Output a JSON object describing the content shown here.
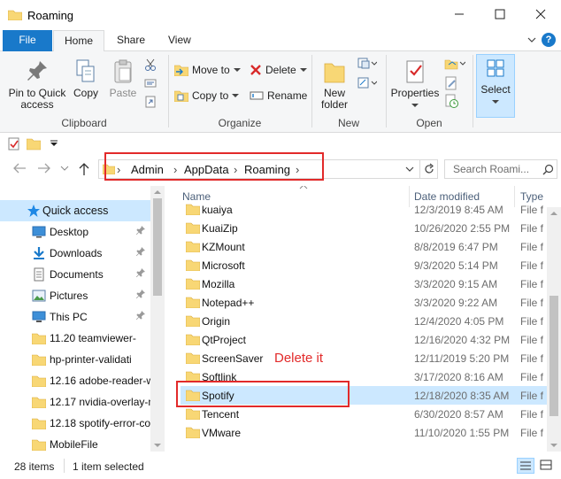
{
  "window": {
    "title": "Roaming"
  },
  "tabs": [
    {
      "label": "File"
    },
    {
      "label": "Home"
    },
    {
      "label": "Share"
    },
    {
      "label": "View"
    }
  ],
  "ribbon": {
    "clipboard": {
      "label": "Clipboard",
      "pin": "Pin to Quick\naccess",
      "pin_l1": "Pin to Quick",
      "pin_l2": "access",
      "copy": "Copy",
      "paste": "Paste"
    },
    "organize": {
      "label": "Organize",
      "move_to": "Move to",
      "copy_to": "Copy to",
      "delete": "Delete",
      "rename": "Rename"
    },
    "new": {
      "label": "New",
      "new_folder_l1": "New",
      "new_folder_l2": "folder"
    },
    "open": {
      "label": "Open",
      "properties": "Properties"
    },
    "select": {
      "label": "Select"
    }
  },
  "address": {
    "crumbs": [
      "Admin",
      "AppData",
      "Roaming"
    ],
    "search_placeholder": "Search Roami..."
  },
  "nav": {
    "items": [
      {
        "label": "Quick access",
        "pinned": false
      },
      {
        "label": "Desktop",
        "pinned": true
      },
      {
        "label": "Downloads",
        "pinned": true
      },
      {
        "label": "Documents",
        "pinned": true
      },
      {
        "label": "Pictures",
        "pinned": true
      },
      {
        "label": "This PC",
        "pinned": true
      },
      {
        "label": "11.20 teamviewer-",
        "pinned": false
      },
      {
        "label": "hp-printer-validati",
        "pinned": false
      },
      {
        "label": "12.16 adobe-reader-w",
        "pinned": false
      },
      {
        "label": "12.17 nvidia-overlay-n",
        "pinned": false
      },
      {
        "label": "12.18 spotify-error-co",
        "pinned": false
      },
      {
        "label": "MobileFile",
        "pinned": false
      }
    ]
  },
  "columns": {
    "name": "Name",
    "date": "Date modified",
    "type": "Type"
  },
  "files": [
    {
      "name": "kuaiya",
      "date": "12/3/2019 8:45 AM",
      "type": "File f"
    },
    {
      "name": "KuaiZip",
      "date": "10/26/2020 2:55 PM",
      "type": "File f"
    },
    {
      "name": "KZMount",
      "date": "8/8/2019 6:47 PM",
      "type": "File f"
    },
    {
      "name": "Microsoft",
      "date": "9/3/2020 5:14 PM",
      "type": "File f"
    },
    {
      "name": "Mozilla",
      "date": "3/3/2020 9:15 AM",
      "type": "File f"
    },
    {
      "name": "Notepad++",
      "date": "3/3/2020 9:22 AM",
      "type": "File f"
    },
    {
      "name": "Origin",
      "date": "12/4/2020 4:05 PM",
      "type": "File f"
    },
    {
      "name": "QtProject",
      "date": "12/16/2020 4:32 PM",
      "type": "File f"
    },
    {
      "name": "ScreenSaver",
      "date": "12/11/2019 5:20 PM",
      "type": "File f"
    },
    {
      "name": "Softlink",
      "date": "3/17/2020 8:16 AM",
      "type": "File f"
    },
    {
      "name": "Spotify",
      "date": "12/18/2020 8:35 AM",
      "type": "File f"
    },
    {
      "name": "Tencent",
      "date": "6/30/2020 8:57 AM",
      "type": "File f"
    },
    {
      "name": "VMware",
      "date": "11/10/2020 1:55 PM",
      "type": "File f"
    }
  ],
  "annotation": "Delete it",
  "status": {
    "count": "28 items",
    "selected": "1 item selected"
  },
  "colors": {
    "accent": "#1979ca",
    "selection": "#cce8ff",
    "annotation": "#e22a2a",
    "folder": "#f8d775"
  }
}
